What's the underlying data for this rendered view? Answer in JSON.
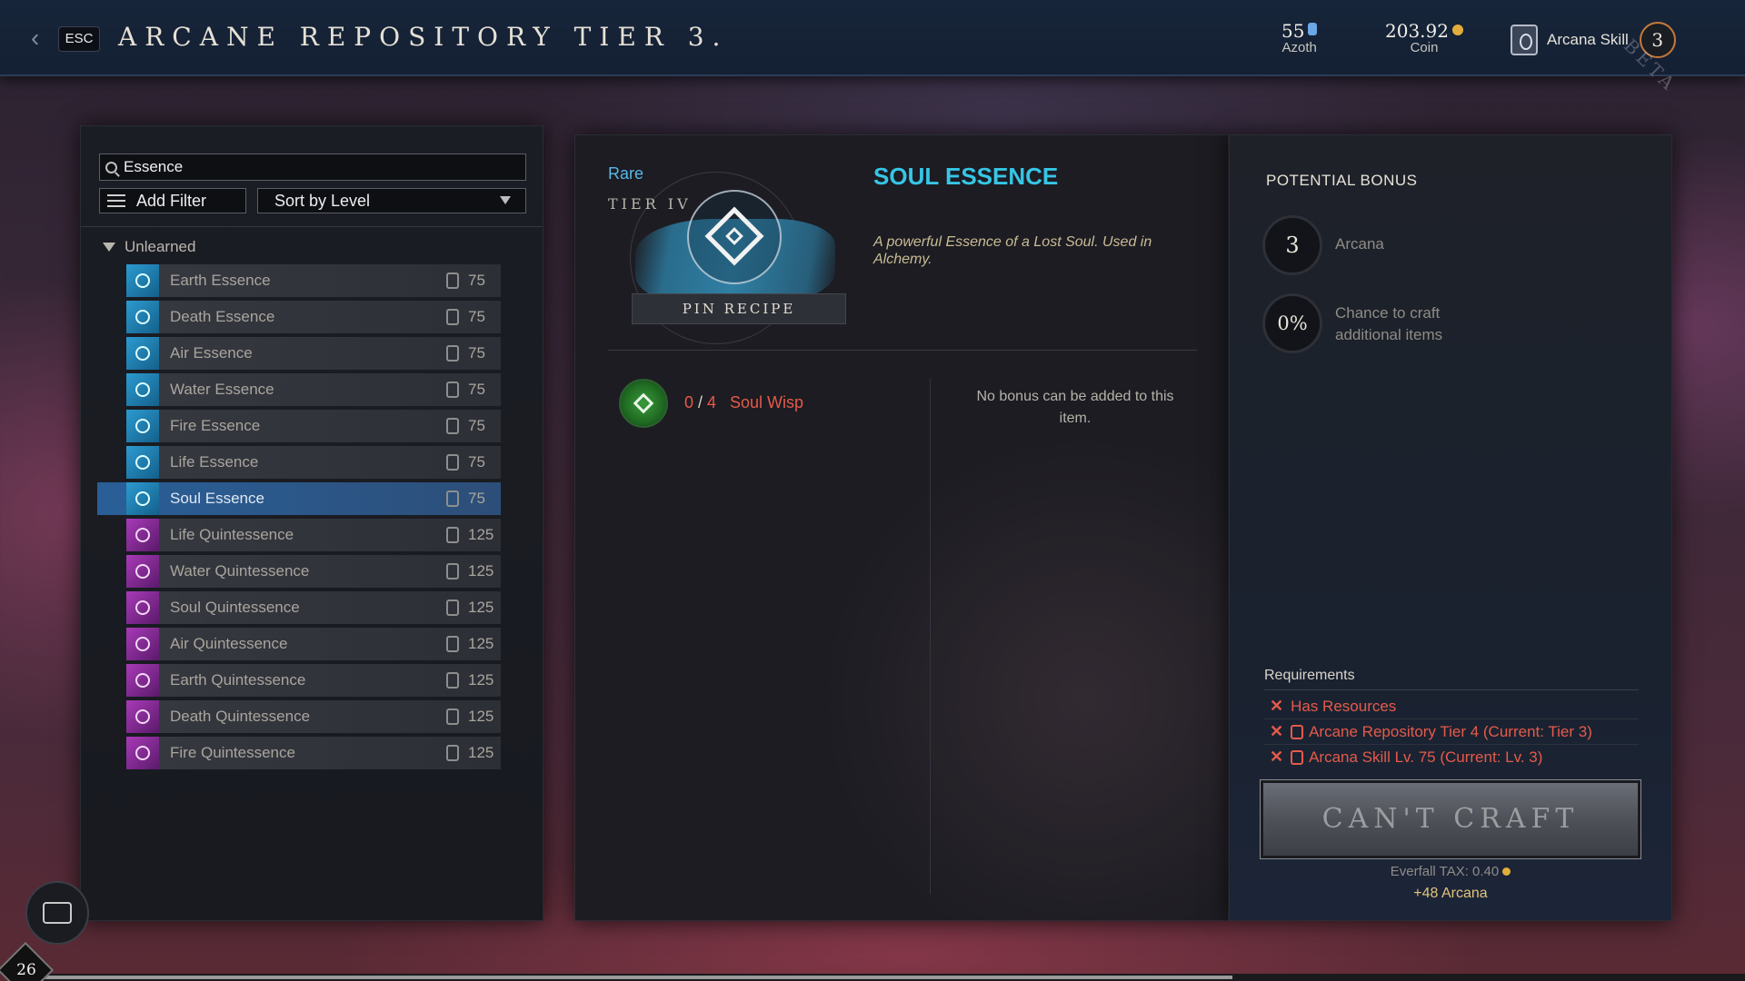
{
  "header": {
    "esc_label": "ESC",
    "title": "ARCANE REPOSITORY TIER 3.",
    "azoth_value": "55",
    "azoth_label": "Azoth",
    "coin_value": "203.92",
    "coin_label": "Coin",
    "skill_label": "Arcana Skill",
    "skill_level": "3",
    "watermark": "BETA"
  },
  "filters": {
    "search_value": "Essence",
    "add_filter_label": "Add Filter",
    "sort_label": "Sort by Level"
  },
  "recipe_group": "Unlearned",
  "recipes": [
    {
      "name": "Earth Essence",
      "level": "75",
      "kind": "essence"
    },
    {
      "name": "Death Essence",
      "level": "75",
      "kind": "essence"
    },
    {
      "name": "Air Essence",
      "level": "75",
      "kind": "essence"
    },
    {
      "name": "Water Essence",
      "level": "75",
      "kind": "essence"
    },
    {
      "name": "Fire Essence",
      "level": "75",
      "kind": "essence"
    },
    {
      "name": "Life Essence",
      "level": "75",
      "kind": "essence"
    },
    {
      "name": "Soul Essence",
      "level": "75",
      "kind": "essence",
      "selected": true
    },
    {
      "name": "Life Quintessence",
      "level": "125",
      "kind": "quint"
    },
    {
      "name": "Water Quintessence",
      "level": "125",
      "kind": "quint"
    },
    {
      "name": "Soul Quintessence",
      "level": "125",
      "kind": "quint"
    },
    {
      "name": "Air Quintessence",
      "level": "125",
      "kind": "quint"
    },
    {
      "name": "Earth Quintessence",
      "level": "125",
      "kind": "quint"
    },
    {
      "name": "Death Quintessence",
      "level": "125",
      "kind": "quint"
    },
    {
      "name": "Fire Quintessence",
      "level": "125",
      "kind": "quint"
    }
  ],
  "detail": {
    "rarity": "Rare",
    "tier": "TIER IV",
    "pin_label": "PIN RECIPE",
    "name": "SOUL ESSENCE",
    "description": "A powerful Essence of a Lost Soul. Used in Alchemy.",
    "ingredient": {
      "have": "0",
      "need": "4",
      "name": "Soul Wisp"
    },
    "no_bonus": "No bonus can be added to this item."
  },
  "bonus": {
    "title": "POTENTIAL BONUS",
    "arcana_value": "3",
    "arcana_label": "Arcana",
    "chance_value": "0%",
    "chance_label": "Chance to craft additional items"
  },
  "requirements": {
    "title": "Requirements",
    "items": [
      "Has Resources",
      "Arcane Repository Tier 4 (Current: Tier 3)",
      "Arcana Skill Lv. 75 (Current: Lv. 3)"
    ]
  },
  "craft": {
    "button_label": "CAN'T CRAFT",
    "tax_label": "Everfall TAX: 0.40",
    "xp_label": "+48 Arcana"
  },
  "player": {
    "level": "26",
    "xp_progress": 0.7
  },
  "colors": {
    "accent_blue": "#36c6e6",
    "rarity_blue": "#5ab8e6",
    "error_red": "#e55a4a",
    "xp_gold": "#e0c47a"
  }
}
